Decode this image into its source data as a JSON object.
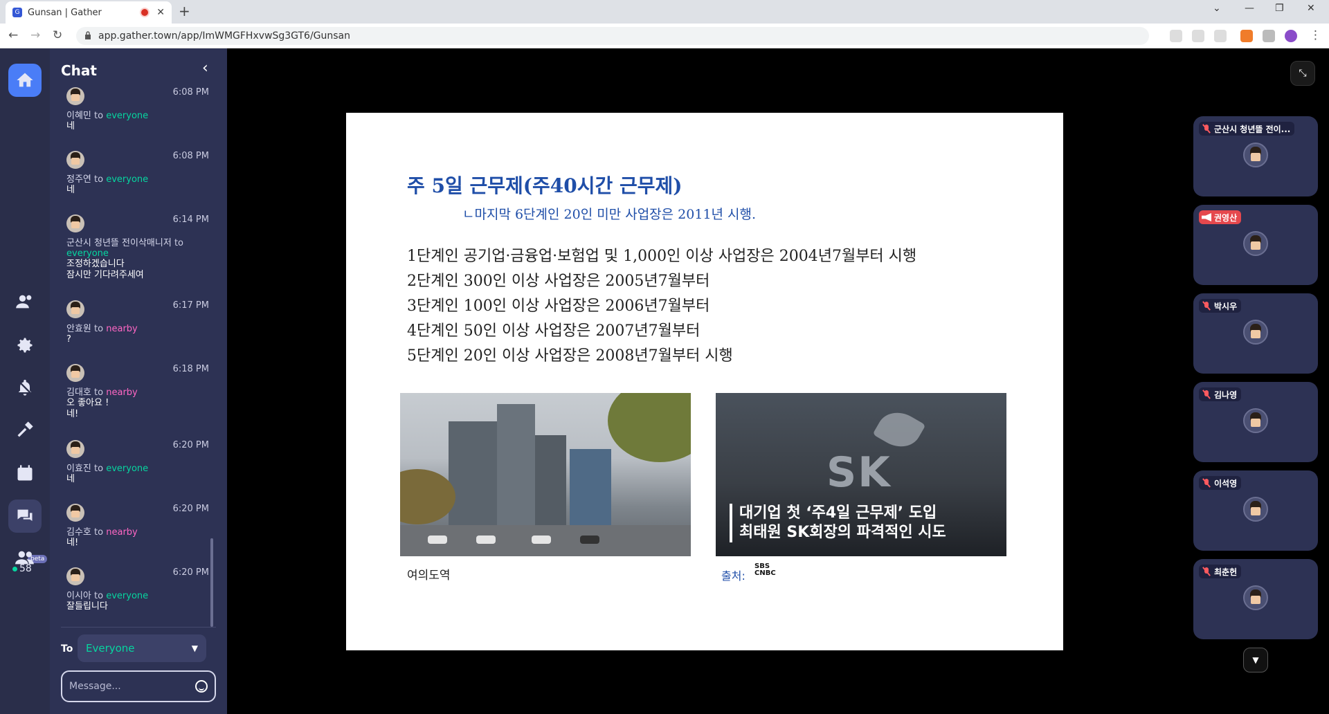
{
  "browser": {
    "tab_title": "Gunsan | Gather",
    "new_tab": "+",
    "url": "app.gather.town/app/ImWMGFHxvwSg3GT6/Gunsan"
  },
  "rail": {
    "online_count": "58",
    "beta_label": "beta"
  },
  "chat": {
    "title": "Chat",
    "messages": [
      {
        "sender": "이혜민",
        "to": "to",
        "audience": "everyone",
        "time": "6:08 PM",
        "text": "네"
      },
      {
        "sender": "정주연",
        "to": "to",
        "audience": "everyone",
        "time": "6:08 PM",
        "text": "네"
      },
      {
        "sender": "군산시 청년뜰 전이삭매니저",
        "to": "to",
        "audience": "everyone",
        "time": "6:14 PM",
        "text": "조정하겠습니다\n잠시만 기다려주세여"
      },
      {
        "sender": "안효원",
        "to": "to",
        "audience": "nearby",
        "time": "6:17 PM",
        "text": "?"
      },
      {
        "sender": "김대호",
        "to": "to",
        "audience": "nearby",
        "time": "6:18 PM",
        "text": "오 좋아요 !\n네!"
      },
      {
        "sender": "이효진",
        "to": "to",
        "audience": "everyone",
        "time": "6:20 PM",
        "text": "네"
      },
      {
        "sender": "김수호",
        "to": "to",
        "audience": "nearby",
        "time": "6:20 PM",
        "text": "네!"
      },
      {
        "sender": "이시아",
        "to": "to",
        "audience": "everyone",
        "time": "6:20 PM",
        "text": "잘들립니다"
      }
    ],
    "to_label": "To",
    "to_value": "Everyone",
    "input_placeholder": "Message..."
  },
  "slide": {
    "title": "주 5일 근무제(주40시간 근무제)",
    "subtitle": "ㄴ마지막 6단계인 20인 미만 사업장은 2011년 시행.",
    "lines": [
      "1단계인 공기업·금융업·보험업 및 1,000인 이상 사업장은 2004년7월부터 시행",
      "2단계인 300인 이상 사업장은 2005년7월부터",
      "3단계인 100인 이상 사업장은 2006년7월부터",
      "4단계인 50인 이상 사업장은 2007년7월부터",
      "5단계인 20인 이상 사업장은 2008년7월부터 시행"
    ],
    "photo1_caption": "여의도역",
    "photo2_logo": "SK",
    "photo2_line1": "대기업 첫 ‘주4일 근무제’ 도입",
    "photo2_line2": "최태원 SK회장의 파격적인 시도",
    "photo2_caption": "출처:",
    "source_logo_top": "SBS",
    "source_logo_bottom": "CNBC"
  },
  "participants": [
    {
      "name": "군산시 청년뜰 전이...",
      "status": "muted"
    },
    {
      "name": "권영산",
      "status": "speaking"
    },
    {
      "name": "박시우",
      "status": "muted"
    },
    {
      "name": "김나영",
      "status": "muted"
    },
    {
      "name": "이석영",
      "status": "muted"
    },
    {
      "name": "최춘헌",
      "status": "muted"
    }
  ],
  "colors": {
    "rail": "#2a2e4a",
    "panel": "#2d3254",
    "accent_everyone": "#06d6a0",
    "accent_nearby": "#ff66c4",
    "home_button": "#4a7df7"
  }
}
